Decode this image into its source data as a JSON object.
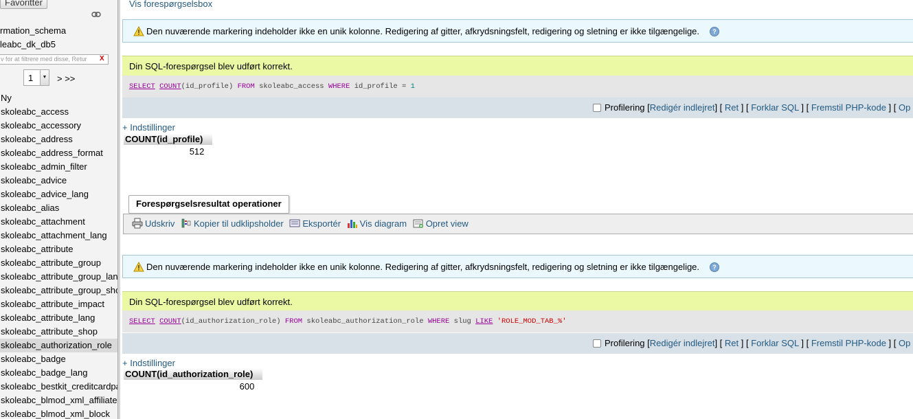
{
  "nav": {
    "favorites_label": "Favoritter",
    "databases": [
      "rmation_schema",
      "leabc_dk_db5"
    ],
    "filter_placeholder": "v for at filtrere med disse, Retur",
    "filter_clear": "X",
    "page_value": "1",
    "page_next": "> >>",
    "new_label": "Ny",
    "tables": [
      "skoleabc_access",
      "skoleabc_accessory",
      "skoleabc_address",
      "skoleabc_address_format",
      "skoleabc_admin_filter",
      "skoleabc_advice",
      "skoleabc_advice_lang",
      "skoleabc_alias",
      "skoleabc_attachment",
      "skoleabc_attachment_lang",
      "skoleabc_attribute",
      "skoleabc_attribute_group",
      "skoleabc_attribute_group_lan",
      "skoleabc_attribute_group_sho",
      "skoleabc_attribute_impact",
      "skoleabc_attribute_lang",
      "skoleabc_attribute_shop",
      "skoleabc_authorization_role",
      "skoleabc_badge",
      "skoleabc_badge_lang",
      "skoleabc_bestkit_creditcardpa",
      "skoleabc_blmod_xml_affiliate",
      "skoleabc_blmod_xml_block"
    ],
    "active_table": "skoleabc_authorization_role"
  },
  "main": {
    "top_link": "Vis forespørgselsbox",
    "notice_text": "Den nuværende markering indeholder ikke en unik kolonne. Redigering af gitter, afkrydsningsfelt, redigering og sletning er ikke tilgængelige.",
    "success_text": "Din SQL-forespørgsel blev udført korrekt.",
    "tools": {
      "profiling": "Profilering",
      "edit_inline": "Redigér indlejret",
      "edit": "Ret",
      "explain": "Forklar SQL",
      "php": "Fremstil PHP-kode",
      "refresh": "Op"
    },
    "settings_link": "+ Indstillinger",
    "query1": {
      "parts": [
        "SELECT",
        "COUNT",
        "(id_profile) ",
        "FROM",
        " skoleabc_access ",
        "WHERE",
        " id_profile = ",
        "1"
      ],
      "column": "COUNT(id_profile)",
      "value": "512"
    },
    "operations": {
      "legend": "Forespørgselsresultat operationer",
      "print": "Udskriv",
      "copy": "Kopier til udklipsholder",
      "export": "Eksportér",
      "chart": "Vis diagram",
      "view": "Opret view"
    },
    "query2": {
      "parts": [
        "SELECT",
        "COUNT",
        "(id_authorization_role) ",
        "FROM",
        " skoleabc_authorization_role ",
        "WHERE",
        " slug ",
        "LIKE",
        " ",
        "'ROLE_MOD_TAB_%'"
      ],
      "column": "COUNT(id_authorization_role)",
      "value": "600"
    }
  }
}
